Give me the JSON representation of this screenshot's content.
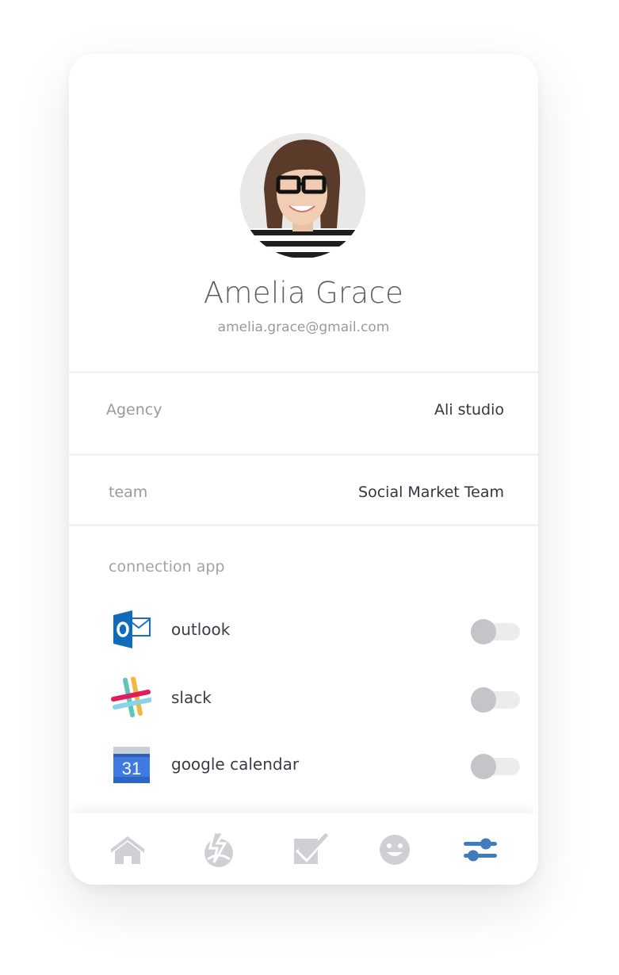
{
  "profile": {
    "name": "Amelia Grace",
    "email": "amelia.grace@gmail.com",
    "avatar_icon": "user-photo"
  },
  "details": [
    {
      "label": "Agency",
      "value": "Ali studio"
    },
    {
      "label": "team",
      "value": "Social Market Team"
    }
  ],
  "connections": {
    "title": "connection app",
    "apps": [
      {
        "name": "outlook",
        "icon": "outlook-icon",
        "enabled": false
      },
      {
        "name": "slack",
        "icon": "slack-icon",
        "enabled": false
      },
      {
        "name": "google calendar",
        "icon": "google-calendar-icon",
        "enabled": false,
        "icon_text": "31"
      }
    ]
  },
  "nav": {
    "items": [
      {
        "icon": "home-icon",
        "active": false
      },
      {
        "icon": "activity-icon",
        "active": false
      },
      {
        "icon": "tasks-check-icon",
        "active": false
      },
      {
        "icon": "smiley-icon",
        "active": false
      },
      {
        "icon": "settings-sliders-icon",
        "active": true
      }
    ],
    "active_color": "#3f7dbf",
    "inactive_color": "#cfd0d4"
  }
}
